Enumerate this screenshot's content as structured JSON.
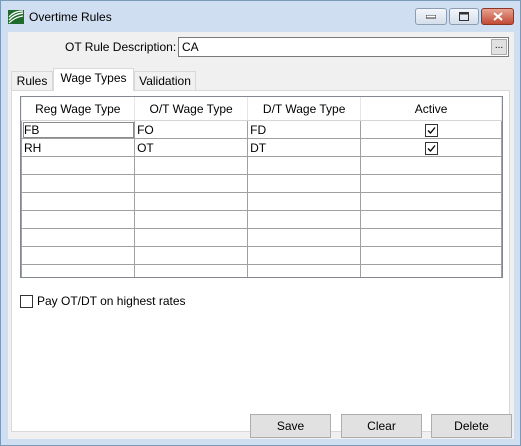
{
  "window": {
    "title": "Overtime Rules"
  },
  "form": {
    "ot_rule_label": "OT Rule Description:",
    "ot_rule_value": "CA",
    "ellipsis_label": "..."
  },
  "tabs": [
    {
      "label": "Rules",
      "active": false
    },
    {
      "label": "Wage Types",
      "active": true
    },
    {
      "label": "Validation",
      "active": false
    }
  ],
  "grid": {
    "columns": [
      "Reg Wage Type",
      "O/T Wage Type",
      "D/T Wage Type",
      "Active"
    ],
    "rows": [
      {
        "reg": "FB",
        "ot": "FO",
        "dt": "FD",
        "active": true
      },
      {
        "reg": "RH",
        "ot": "OT",
        "dt": "DT",
        "active": true
      }
    ]
  },
  "pay_option": {
    "label": "Pay OT/DT on highest rates",
    "checked": false
  },
  "buttons": {
    "save": "Save",
    "clear": "Clear",
    "delete": "Delete"
  }
}
